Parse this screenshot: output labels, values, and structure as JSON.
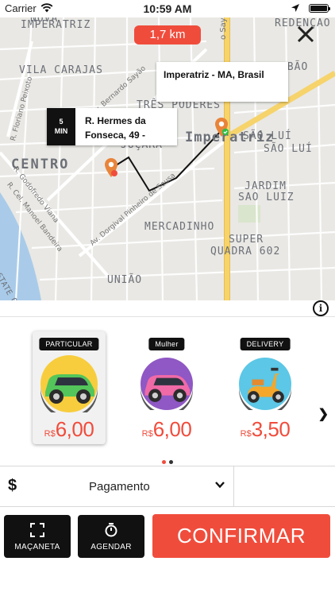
{
  "status_bar": {
    "carrier": "Carrier",
    "time": "10:59 AM"
  },
  "map": {
    "distance": "1,7 km",
    "destination_callout": "Imperatriz - MA, Brasil",
    "origin_callout": {
      "eta_value": "5",
      "eta_unit": "MIN",
      "address": "R. Hermes da\nFonseca, 49 -"
    },
    "area_labels": {
      "nova_imperatriz_top": "NOVA",
      "nova_imperatriz": "IMPERATRIZ",
      "redencao": "REDENÇÃO",
      "vila_carajas": "VILA CARAJAS",
      "vila_lobao": "VILA LOBÃO",
      "tres_poderes": "TRÊS PODERES",
      "imperatriz": "Imperatriz",
      "jucara": "JUÇARA",
      "centro": "CENTRO",
      "sao_luiz_top": "SÃO LUÍ",
      "jardim": "JARDIM",
      "sao_luiz": "SAO LUIZ",
      "mercadinho": "MERCADINHO",
      "super": "SUPER",
      "quadra": "QUADRA 602",
      "uniao": "UNIÃO",
      "state": "STATE O"
    },
    "street_labels": {
      "floriano": "R. Floriano Peixoto",
      "bernardo": "Av. Bernardo Sayão",
      "godofredo": "R. Godofredo Viana",
      "manoel": "R. Cel. Manoel Bandeira",
      "dorgival": "Av. Dorgival Pinheiro de Sousa",
      "sayao_top": "o Sayão"
    }
  },
  "categories": [
    {
      "badge": "PARTICULAR",
      "currency": "R$",
      "value": "6,00",
      "selected": true
    },
    {
      "badge": "Mulher",
      "currency": "R$",
      "value": "6,00",
      "selected": false
    },
    {
      "badge": "DELIVERY",
      "currency": "R$",
      "value": "3,50",
      "selected": false
    }
  ],
  "payment": {
    "icon": "dollar-icon",
    "label": "Pagamento"
  },
  "actions": {
    "macaneta": "MAÇANETA",
    "agendar": "AGENDAR",
    "confirm": "CONFIRMAR"
  },
  "colors": {
    "accent": "#f04c3c",
    "dark": "#111111",
    "map_bg": "#e9e8e4",
    "main_road": "#f6d36b",
    "water": "#a9cbe9"
  }
}
